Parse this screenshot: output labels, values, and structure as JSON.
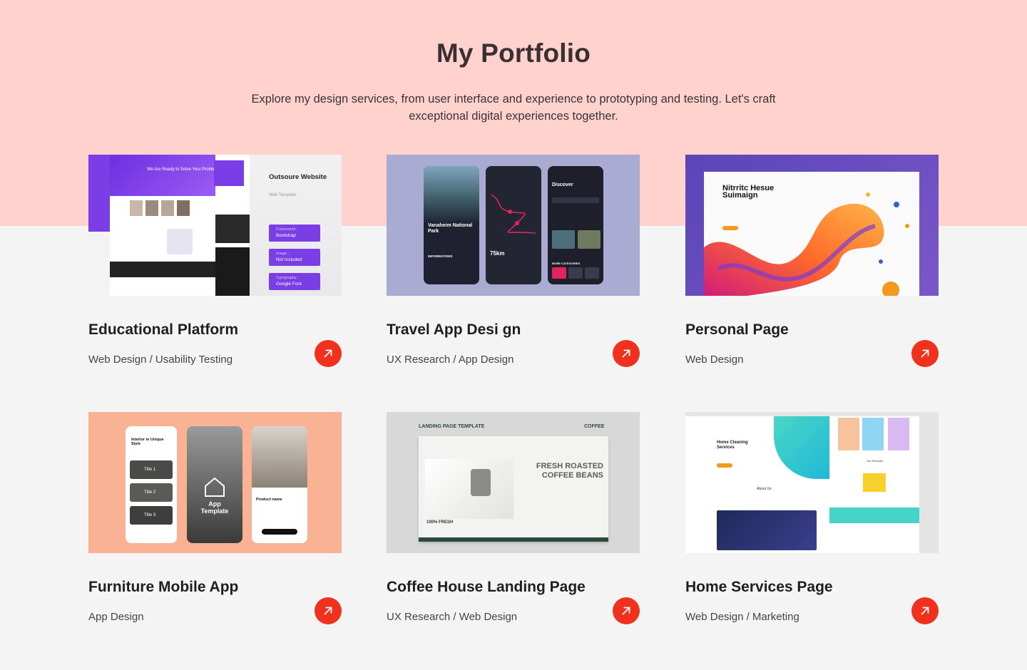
{
  "header": {
    "title": "My Portfolio",
    "subtitle": "Explore my design services, from user interface and experience to prototyping and testing. Let's craft exceptional digital experiences together."
  },
  "colors": {
    "band": "#ffd2ce",
    "background": "#f5f4f5",
    "accent": "#f0311d"
  },
  "projects": [
    {
      "title": "Educational Platform",
      "tags": "Web Design / Usability Testing",
      "arrow_icon": "arrow-up-right-icon",
      "thumb": {
        "heading": "Outsoure Website",
        "caption": "Web Template",
        "hero": "We Are Ready to Solve Your Problem",
        "chips": [
          {
            "label": "Framework :",
            "value": "Bootstrap"
          },
          {
            "label": "Image :",
            "value": "Not Included"
          },
          {
            "label": "Typography :",
            "value": "Google Font"
          }
        ]
      }
    },
    {
      "title": "Travel App Desi gn",
      "tags": "UX Research / App Design",
      "arrow_icon": "arrow-up-right-icon",
      "thumb": {
        "place": "Vanaheim National Park",
        "section": "INFORMATIONS",
        "distance": "75km",
        "discover": "Discover",
        "categories": "MORE CATEGORIES"
      }
    },
    {
      "title": "Personal Page",
      "tags": "Web Design",
      "arrow_icon": "arrow-up-right-icon",
      "thumb": {
        "headline": "Nitrritc Hesue Suimaign"
      }
    },
    {
      "title": "Furniture Mobile App",
      "tags": "App Design",
      "arrow_icon": "arrow-up-right-icon",
      "thumb": {
        "screen1_title": "Interior in Unique Style",
        "items": [
          "Title 1",
          "Title 2",
          "Title 3"
        ],
        "center_label": "App Template",
        "product": "Product name"
      }
    },
    {
      "title": "Coffee House Landing Page",
      "tags": "UX Research / Web Design",
      "arrow_icon": "arrow-up-right-icon",
      "thumb": {
        "left_label": "LANDING PAGE TEMPLATE",
        "right_label": "COFFEE",
        "headline": "FRESH ROASTED COFFEE BEANS",
        "badge": "100% FRESH"
      }
    },
    {
      "title": "Home Services Page",
      "tags": "Web Design / Marketing",
      "arrow_icon": "arrow-up-right-icon",
      "thumb": {
        "hero": "Home Cleaning Services",
        "about": "About Us",
        "services": "Our Services"
      }
    }
  ]
}
